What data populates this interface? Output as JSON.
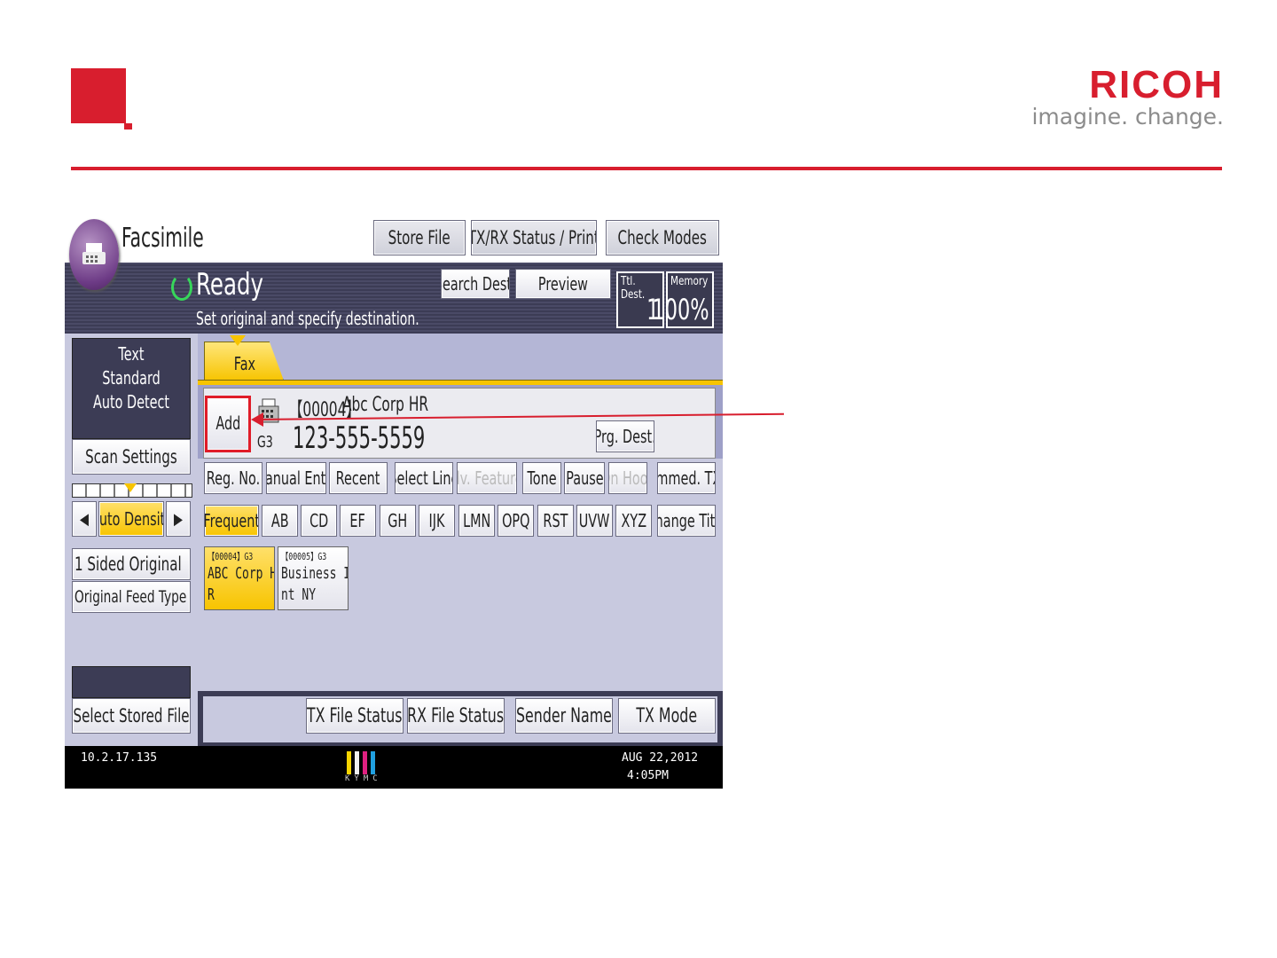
{
  "brand": {
    "name": "RICOH",
    "tagline": "imagine. change."
  },
  "app": {
    "title": "Facsimile",
    "top_buttons": {
      "store_file": "Store File",
      "txrx_status": "TX/RX Status / Print",
      "check_modes": "Check Modes"
    },
    "status": {
      "state": "Ready",
      "message": "Set original and specify destination."
    },
    "actions": {
      "search_dest": "Search Dest.",
      "preview": "Preview"
    },
    "counters": {
      "ttl_dest_label": "Ttl. Dest.",
      "ttl_dest_value": "1",
      "memory_label": "Memory",
      "memory_value": "100%"
    }
  },
  "left_panel": {
    "scan_mode": [
      "Text",
      "Standard",
      "Auto Detect"
    ],
    "scan_settings": "Scan Settings",
    "auto_density": "Auto Density",
    "one_sided": "1 Sided Original",
    "feed_type": "Original Feed Type",
    "select_stored_file": "Select Stored File"
  },
  "tab": {
    "label": "Fax"
  },
  "destination": {
    "add_label": "Add",
    "code": "【00004】",
    "name": "Abc Corp HR",
    "line": "G3",
    "number": "123-555-5559",
    "prg_dest": "Prg. Dest."
  },
  "function_row": [
    "Reg. No.",
    "Manual Entry",
    "Recent",
    "Select Line",
    "Adv. Features",
    "Tone",
    "Pause",
    "On Hook",
    "Immed. TX"
  ],
  "index_row": [
    "Frequent",
    "AB",
    "CD",
    "EF",
    "GH",
    "IJK",
    "LMN",
    "OPQ",
    "RST",
    "UVW",
    "XYZ",
    "Change Title"
  ],
  "destinations": [
    {
      "code": "【00004】G3",
      "name": "ABC Corp HR"
    },
    {
      "code": "【00005】G3",
      "name": "Business Int NY"
    }
  ],
  "bottom_buttons": [
    "TX File Status",
    "RX File Status",
    "Sender Name",
    "TX Mode"
  ],
  "statusbar": {
    "ip": "10.2.17.135",
    "toner": "KYMC",
    "date": "AUG  22,2012",
    "time": "4:05PM"
  }
}
